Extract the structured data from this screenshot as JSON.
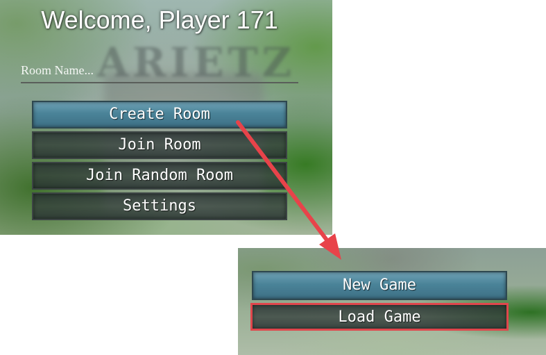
{
  "main": {
    "title": "Welcome, Player 171",
    "room_input": {
      "placeholder": "Room Name...",
      "value": ""
    },
    "buttons": {
      "create_room": "Create Room",
      "join_room": "Join Room",
      "join_random_room": "Join Random Room",
      "settings": "Settings"
    },
    "selected_button": "Create Room"
  },
  "secondary": {
    "buttons": {
      "new_game": "New Game",
      "load_game": "Load Game"
    },
    "selected_button": "New Game",
    "highlighted_button": "Load Game"
  },
  "annotation": {
    "arrow_color": "#e8434a",
    "highlight_color": "#e0464c"
  },
  "colors": {
    "selected_button": "#4a8398",
    "button_bg": "#323c3c",
    "text": "#ffffff"
  }
}
